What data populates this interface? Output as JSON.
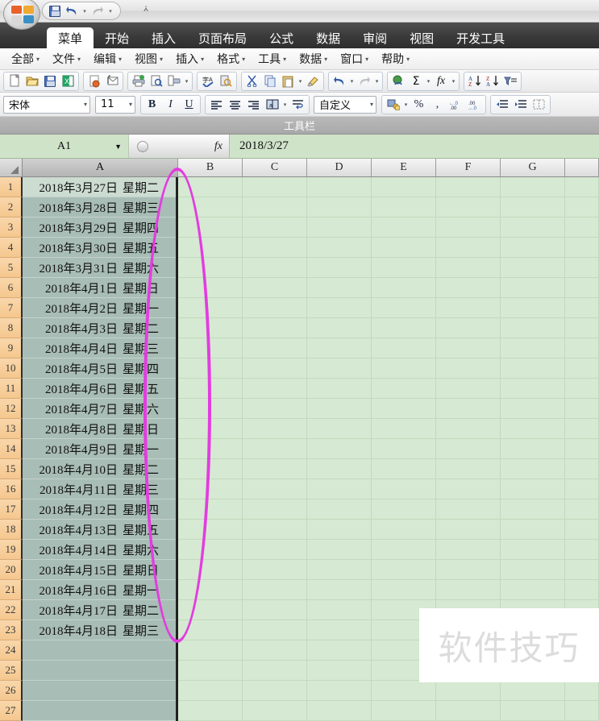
{
  "app": {
    "quick_access": {
      "buttons": [
        {
          "name": "save",
          "icon": "floppy-disk-icon"
        },
        {
          "name": "undo",
          "icon": "undo-arrow-icon"
        },
        {
          "name": "redo",
          "icon": "redo-arrow-icon"
        }
      ],
      "customize_label": "▼"
    },
    "ribbon_tabs": [
      {
        "label": "菜单",
        "active": true
      },
      {
        "label": "开始",
        "active": false
      },
      {
        "label": "插入",
        "active": false
      },
      {
        "label": "页面布局",
        "active": false
      },
      {
        "label": "公式",
        "active": false
      },
      {
        "label": "数据",
        "active": false
      },
      {
        "label": "审阅",
        "active": false
      },
      {
        "label": "视图",
        "active": false
      },
      {
        "label": "开发工具",
        "active": false
      }
    ],
    "menus": [
      {
        "label": "全部"
      },
      {
        "label": "文件"
      },
      {
        "label": "编辑"
      },
      {
        "label": "视图"
      },
      {
        "label": "插入"
      },
      {
        "label": "格式"
      },
      {
        "label": "工具"
      },
      {
        "label": "数据"
      },
      {
        "label": "窗口"
      },
      {
        "label": "帮助"
      }
    ],
    "toolbar_label": "工具栏"
  },
  "formatting": {
    "font_name": "宋体",
    "font_size": "11",
    "bold": "B",
    "italic": "I",
    "underline": "U",
    "number_format": "自定义",
    "percent": "%",
    "comma": ","
  },
  "formula_bar": {
    "name_box": "A1",
    "fx_label": "fx",
    "value": "2018/3/27"
  },
  "sheet": {
    "columns": [
      "A",
      "B",
      "C",
      "D",
      "E",
      "F",
      "G"
    ],
    "selected_column": "A",
    "active_cell": "A1",
    "rows": [
      {
        "n": "1",
        "date": "2018年3月27日",
        "weekday": "星期二"
      },
      {
        "n": "2",
        "date": "2018年3月28日",
        "weekday": "星期三"
      },
      {
        "n": "3",
        "date": "2018年3月29日",
        "weekday": "星期四"
      },
      {
        "n": "4",
        "date": "2018年3月30日",
        "weekday": "星期五"
      },
      {
        "n": "5",
        "date": "2018年3月31日",
        "weekday": "星期六"
      },
      {
        "n": "6",
        "date": "2018年4月1日",
        "weekday": "星期日"
      },
      {
        "n": "7",
        "date": "2018年4月2日",
        "weekday": "星期一"
      },
      {
        "n": "8",
        "date": "2018年4月3日",
        "weekday": "星期二"
      },
      {
        "n": "9",
        "date": "2018年4月4日",
        "weekday": "星期三"
      },
      {
        "n": "10",
        "date": "2018年4月5日",
        "weekday": "星期四"
      },
      {
        "n": "11",
        "date": "2018年4月6日",
        "weekday": "星期五"
      },
      {
        "n": "12",
        "date": "2018年4月7日",
        "weekday": "星期六"
      },
      {
        "n": "13",
        "date": "2018年4月8日",
        "weekday": "星期日"
      },
      {
        "n": "14",
        "date": "2018年4月9日",
        "weekday": "星期一"
      },
      {
        "n": "15",
        "date": "2018年4月10日",
        "weekday": "星期二"
      },
      {
        "n": "16",
        "date": "2018年4月11日",
        "weekday": "星期三"
      },
      {
        "n": "17",
        "date": "2018年4月12日",
        "weekday": "星期四"
      },
      {
        "n": "18",
        "date": "2018年4月13日",
        "weekday": "星期五"
      },
      {
        "n": "19",
        "date": "2018年4月14日",
        "weekday": "星期六"
      },
      {
        "n": "20",
        "date": "2018年4月15日",
        "weekday": "星期日"
      },
      {
        "n": "21",
        "date": "2018年4月16日",
        "weekday": "星期一"
      },
      {
        "n": "22",
        "date": "2018年4月17日",
        "weekday": "星期二"
      },
      {
        "n": "23",
        "date": "2018年4月18日",
        "weekday": "星期三"
      },
      {
        "n": "24",
        "date": "",
        "weekday": ""
      },
      {
        "n": "25",
        "date": "",
        "weekday": ""
      },
      {
        "n": "26",
        "date": "",
        "weekday": ""
      },
      {
        "n": "27",
        "date": "",
        "weekday": ""
      }
    ]
  },
  "annotation": {
    "ellipse_color": "#e33ce0",
    "watermark_text": "软件技巧"
  },
  "colors": {
    "sheet_bg": "#d6e9d2",
    "selected_col": "#a8bdb5",
    "active_cell": "#ccdcd1",
    "row_header": "#f5c78e",
    "formula_bar": "#cfe3c9",
    "tabstrip": "#3a3a3a"
  }
}
